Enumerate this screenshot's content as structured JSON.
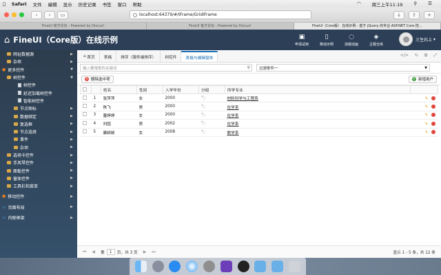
{
  "menubar": {
    "apple": "",
    "app": "Safari",
    "items": [
      "文件",
      "编辑",
      "显示",
      "历史记录",
      "书签",
      "窗口",
      "帮助"
    ],
    "clock": "周三上午11:19"
  },
  "browser": {
    "url": "localhost:64379/#/IFrame/GridIFrame",
    "tabs": [
      "FineUI 官方论坛 - Powered by Discuz!",
      "FineUI 官方论坛 - Powered by Discuz!",
      "FineUI（Core版） 在线示例 - 基于 jQuery 的专业 ASP.NET Core 控..."
    ]
  },
  "header": {
    "title": "FineUI（Core版）在线示例",
    "buttons": [
      "申请试用",
      "移动示例",
      "加载动画",
      "主题仓库"
    ],
    "user": "三生石上"
  },
  "sidebar": {
    "items": [
      "网址数据源",
      "杂项",
      "更多控件",
      "树控件",
      "树控件",
      "延迟加载树控件",
      "智能树控件",
      "节点图标",
      "数据绑定",
      "复选框",
      "节点选择",
      "事件",
      "杂项",
      "选项卡控件",
      "手风琴控件",
      "面板控件",
      "窗体控件",
      "工具栏和菜单",
      "移动控件",
      "页面布局",
      "内联框架"
    ]
  },
  "tabs": [
    "首页",
    "表格",
    "排序（服务端排序）",
    "树控件",
    "表格与编辑窗体"
  ],
  "search": {
    "placeholder": "输入要搜索的关键词",
    "filter": "过滤条件一"
  },
  "toolbar": {
    "delete": "删除选中项",
    "add": "新增用户"
  },
  "table": {
    "headers": [
      "",
      "",
      "姓名",
      "性别",
      "入学年份",
      "分组",
      "所学专业"
    ],
    "rows": [
      {
        "n": "1",
        "name": "张萍萍",
        "sex": "女",
        "year": "2000",
        "major": "材料科学与工程系"
      },
      {
        "n": "2",
        "name": "陈飞",
        "sex": "男",
        "year": "2000",
        "major": "化学系"
      },
      {
        "n": "3",
        "name": "董婷婷",
        "sex": "女",
        "year": "2000",
        "major": "化学系"
      },
      {
        "n": "4",
        "name": "刘国",
        "sex": "男",
        "year": "2002",
        "major": "化学系"
      },
      {
        "n": "5",
        "name": "康颖颖",
        "sex": "女",
        "year": "2008",
        "major": "数学系"
      }
    ]
  },
  "pager": {
    "pre": "第",
    "page": "1",
    "post": "页，共 3 页",
    "info": "显示 1 - 5 条，共 12 条"
  },
  "colors": {
    "header": "#2c3f57",
    "accent": "#1a6fb8",
    "danger": "#e0463c",
    "success": "#3e9b3e"
  }
}
